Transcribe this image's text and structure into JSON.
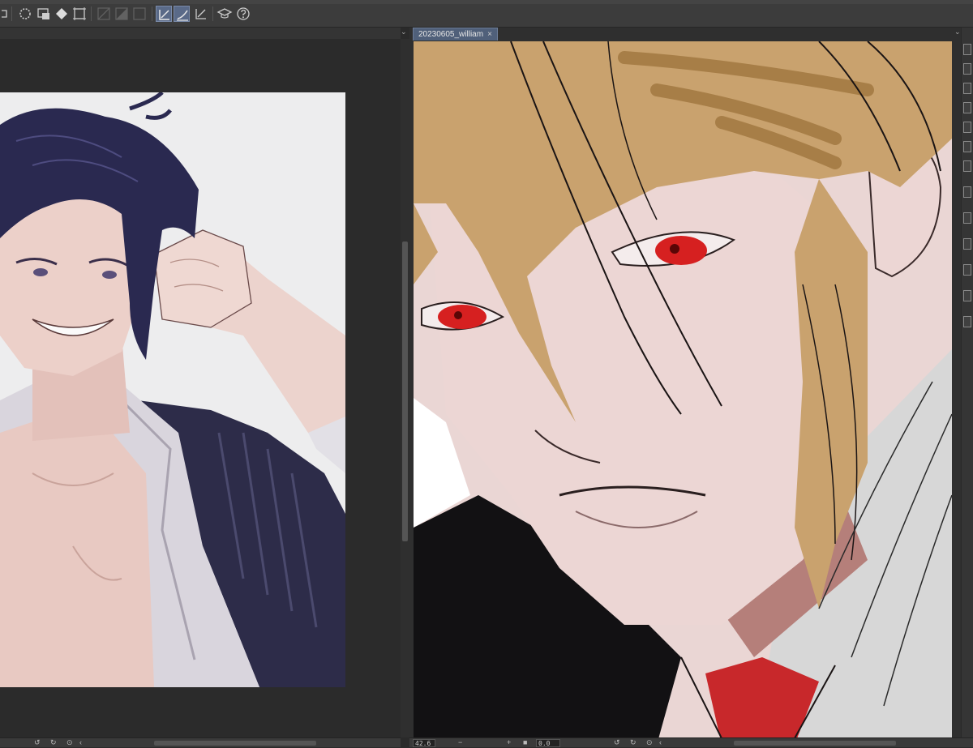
{
  "toolbar": {
    "icons": [
      {
        "name": "selection-launcher-icon",
        "state": "normal"
      },
      {
        "name": "snap-icon",
        "state": "normal"
      },
      {
        "name": "fill-icon",
        "state": "normal"
      },
      {
        "name": "transform-icon",
        "state": "normal"
      },
      {
        "name": "ruler-snap-disabled-icon",
        "state": "disabled"
      },
      {
        "name": "special-ruler-disabled-icon",
        "state": "disabled"
      },
      {
        "name": "grid-disabled-icon",
        "state": "disabled"
      },
      {
        "name": "snap-to-ruler-icon",
        "state": "active"
      },
      {
        "name": "snap-to-special-ruler-icon",
        "state": "active"
      },
      {
        "name": "snap-to-grid-icon",
        "state": "normal"
      },
      {
        "name": "learn-icon",
        "state": "normal"
      },
      {
        "name": "help-icon",
        "state": "normal"
      }
    ]
  },
  "document_tab": {
    "title": "20230605_william",
    "close_glyph": "×"
  },
  "status": {
    "right_zoom": "42.6",
    "right_rotation": "0.0"
  },
  "colors": {
    "ui_dark": "#2b2b2b",
    "toolbar": "#3c3c3c",
    "tab_active": "#50607a",
    "left_canvas_bg": "#ededee",
    "right_hair": "#c9a26e",
    "eye_red": "#d62020",
    "tie_red": "#c8282b"
  }
}
